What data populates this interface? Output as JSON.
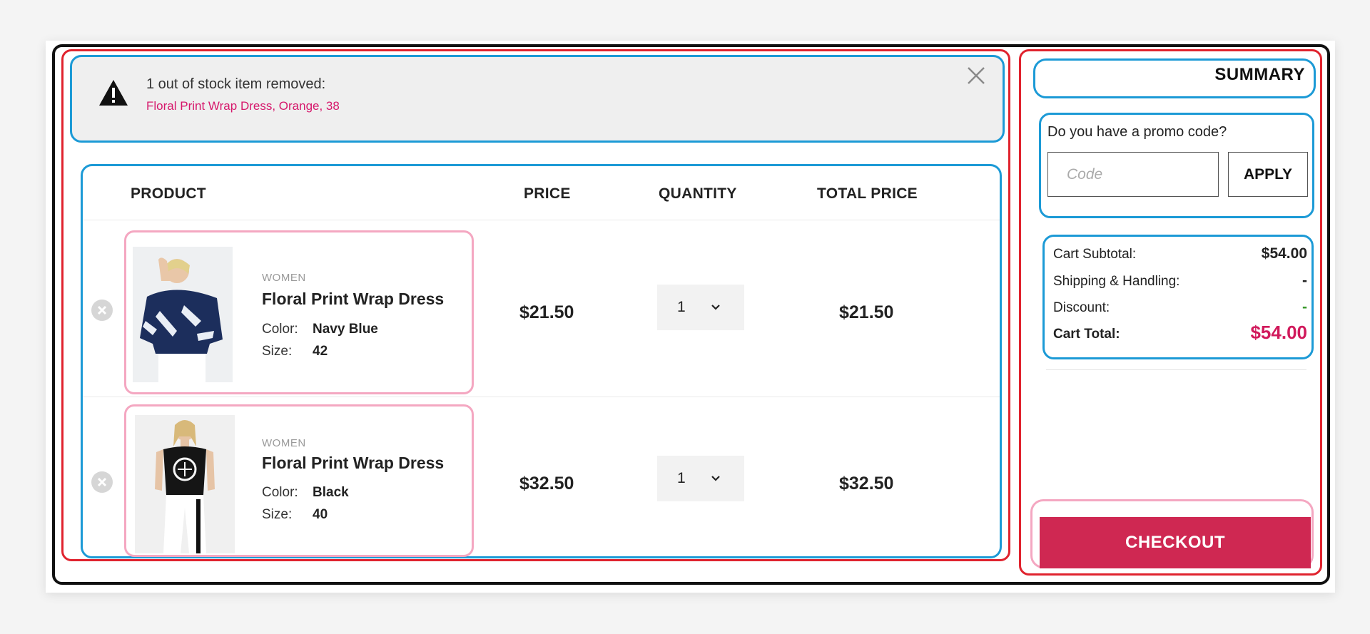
{
  "alert": {
    "title": "1 out of stock item removed:",
    "item": "Floral Print Wrap Dress, Orange, 38",
    "icon": "warning-triangle-icon",
    "close_icon": "close-icon"
  },
  "cart": {
    "headers": {
      "product": "PRODUCT",
      "price": "PRICE",
      "quantity": "QUANTITY",
      "total": "TOTAL PRICE"
    },
    "color_label": "Color:",
    "size_label": "Size:",
    "items": [
      {
        "category": "WOMEN",
        "name": "Floral Print Wrap Dress",
        "color": "Navy Blue",
        "size": "42",
        "price": "$21.50",
        "quantity": "1",
        "total": "$21.50"
      },
      {
        "category": "WOMEN",
        "name": "Floral Print Wrap Dress",
        "color": "Black",
        "size": "40",
        "price": "$32.50",
        "quantity": "1",
        "total": "$32.50"
      }
    ]
  },
  "summary": {
    "title": "SUMMARY",
    "promo_question": "Do you have a promo code?",
    "promo_placeholder": "Code",
    "apply_label": "APPLY",
    "subtotal_label": "Cart Subtotal:",
    "subtotal_value": "$54.00",
    "shipping_label": "Shipping & Handling:",
    "shipping_value": "-",
    "discount_label": "Discount:",
    "discount_value": "-",
    "total_label": "Cart Total:",
    "total_value": "$54.00",
    "checkout_label": "CHECKOUT"
  },
  "colors": {
    "accent": "#cf2852",
    "alert_link": "#d6186c",
    "annotation_red": "#e0232e",
    "annotation_blue": "#1c9ad6",
    "annotation_pink": "#f4a7c1"
  }
}
